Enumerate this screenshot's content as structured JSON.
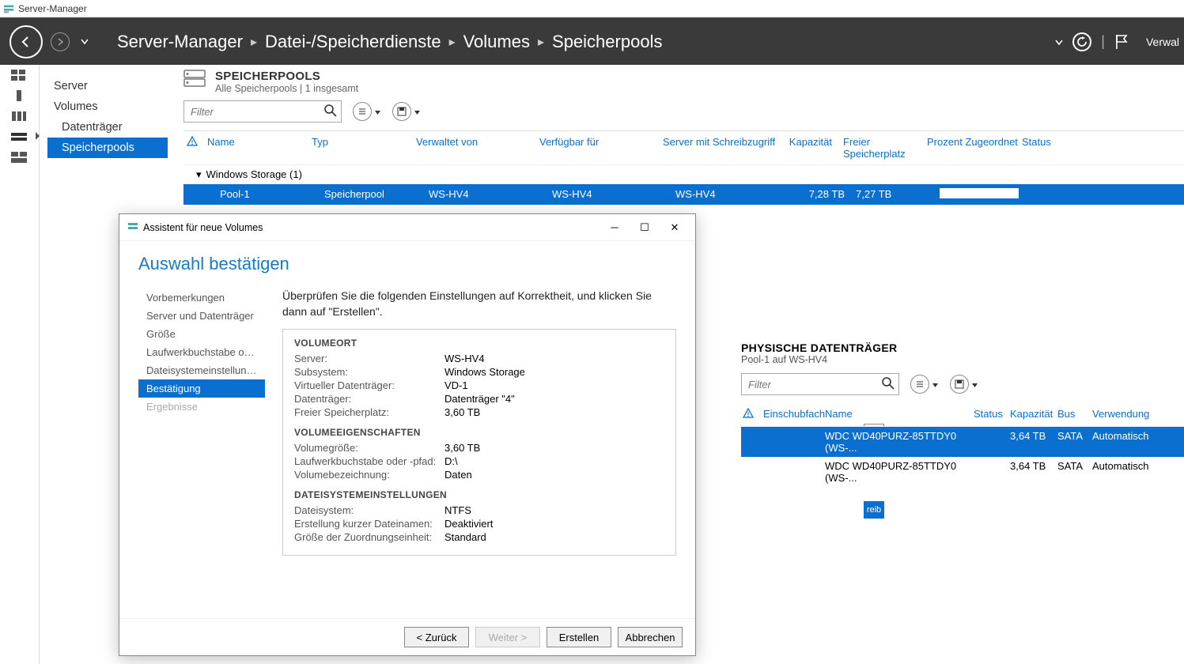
{
  "app_title": "Server-Manager",
  "breadcrumb": [
    "Server-Manager",
    "Datei-/Speicherdienste",
    "Volumes",
    "Speicherpools"
  ],
  "rightmenu": {
    "verwalten": "Verwal"
  },
  "leftnav": {
    "items": [
      {
        "label": "Server",
        "sub": false,
        "selected": false
      },
      {
        "label": "Volumes",
        "sub": false,
        "selected": false
      },
      {
        "label": "Datenträger",
        "sub": true,
        "selected": false
      },
      {
        "label": "Speicherpools",
        "sub": true,
        "selected": true
      }
    ]
  },
  "pools": {
    "title": "SPEICHERPOOLS",
    "subtitle": "Alle Speicherpools | 1 insgesamt",
    "filter_placeholder": "Filter",
    "columns": {
      "name": "Name",
      "typ": "Typ",
      "verwaltet": "Verwaltet von",
      "verfuegbar": "Verfügbar für",
      "server": "Server mit Schreibzugriff",
      "kap": "Kapazität",
      "frei": "Freier Speicherplatz",
      "prozent": "Prozent Zugeordnet",
      "status": "Status"
    },
    "group": "Windows Storage (1)",
    "row": {
      "name": "Pool-1",
      "typ": "Speicherpool",
      "verwaltet": "WS-HV4",
      "verfuegbar": "WS-HV4",
      "server": "WS-HV4",
      "kap": "7,28 TB",
      "frei": "7,27 TB"
    }
  },
  "phys": {
    "title": "PHYSISCHE DATENTRÄGER",
    "subtitle": "Pool-1 auf WS-HV4",
    "filter_placeholder": "Filter",
    "columns": {
      "slot": "Einschubfach",
      "name": "Name",
      "status": "Status",
      "kap": "Kapazität",
      "bus": "Bus",
      "use": "Verwendung"
    },
    "rows": [
      {
        "name": "WDC WD40PURZ-85TTDY0 (WS-...",
        "kap": "3,64 TB",
        "bus": "SATA",
        "use": "Automatisch",
        "sel": true
      },
      {
        "name": "WDC WD40PURZ-85TTDY0 (WS-...",
        "kap": "3,64 TB",
        "bus": "SATA",
        "use": "Automatisch",
        "sel": false
      }
    ]
  },
  "peek_text": "reib",
  "wizard": {
    "window_title": "Assistent für neue Volumes",
    "heading": "Auswahl bestätigen",
    "intro": "Überprüfen Sie die folgenden Einstellungen auf Korrektheit, und klicken Sie dann auf \"Erstellen\".",
    "steps": [
      {
        "label": "Vorbemerkungen"
      },
      {
        "label": "Server und Datenträger"
      },
      {
        "label": "Größe"
      },
      {
        "label": "Laufwerkbuchstabe oder..."
      },
      {
        "label": "Dateisystemeinstellungen"
      },
      {
        "label": "Bestätigung",
        "active": true
      },
      {
        "label": "Ergebnisse",
        "disabled": true
      }
    ],
    "sections": [
      {
        "title": "VOLUMEORT",
        "rows": [
          {
            "k": "Server:",
            "v": "WS-HV4"
          },
          {
            "k": "Subsystem:",
            "v": "Windows Storage"
          },
          {
            "k": "Virtueller Datenträger:",
            "v": "VD-1"
          },
          {
            "k": "Datenträger:",
            "v": "Datenträger \"4\""
          },
          {
            "k": "Freier Speicherplatz:",
            "v": "3,60 TB"
          }
        ]
      },
      {
        "title": "VOLUMEEIGENSCHAFTEN",
        "rows": [
          {
            "k": "Volumegröße:",
            "v": "3,60 TB"
          },
          {
            "k": "Laufwerkbuchstabe oder -pfad:",
            "v": "D:\\"
          },
          {
            "k": "Volumebezeichnung:",
            "v": "Daten"
          }
        ]
      },
      {
        "title": "DATEISYSTEMEINSTELLUNGEN",
        "rows": [
          {
            "k": "Dateisystem:",
            "v": "NTFS"
          },
          {
            "k": "Erstellung kurzer Dateinamen:",
            "v": "Deaktiviert"
          },
          {
            "k": "Größe der Zuordnungseinheit:",
            "v": "Standard"
          }
        ]
      }
    ],
    "buttons": {
      "back": "< Zurück",
      "next": "Weiter >",
      "create": "Erstellen",
      "cancel": "Abbrechen"
    }
  }
}
